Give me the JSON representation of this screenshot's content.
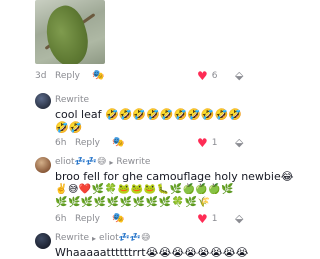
{
  "thread": {
    "top_meta": {
      "time": "3d",
      "reply": "Reply",
      "likes": "6"
    },
    "c1": {
      "author": "Rewrite",
      "text": "cool leaf 🤣🤣🤣🤣🤣🤣🤣🤣🤣🤣",
      "text2": "🤣🤣",
      "time": "6h",
      "reply": "Reply",
      "likes": "1"
    },
    "c2": {
      "author": "eliot💤💤😅",
      "arrow": "▸",
      "reply_to": "Rewrite",
      "text": "broo fell for ghe camouflage holy newbie😂",
      "emoji1": "✌️😅❤️🌿🍀🐸🐸🐸🐛🌿🍏🍏🍏🌿",
      "emoji2": "🌿🌿🌿🌿🌿🌿🌿🌿🌿🍀🌿🌾",
      "time": "6h",
      "reply": "Reply",
      "likes": "1"
    },
    "c3": {
      "author": "Rewrite",
      "arrow": "▸",
      "reply_to": "eliot💤💤😅",
      "text": "Whaaaaattttttrrt😭😭😭😭😭😭😭😭"
    }
  },
  "icons": {
    "reply_icon": "🎭",
    "heart": "♥",
    "dislike": "⬙"
  }
}
